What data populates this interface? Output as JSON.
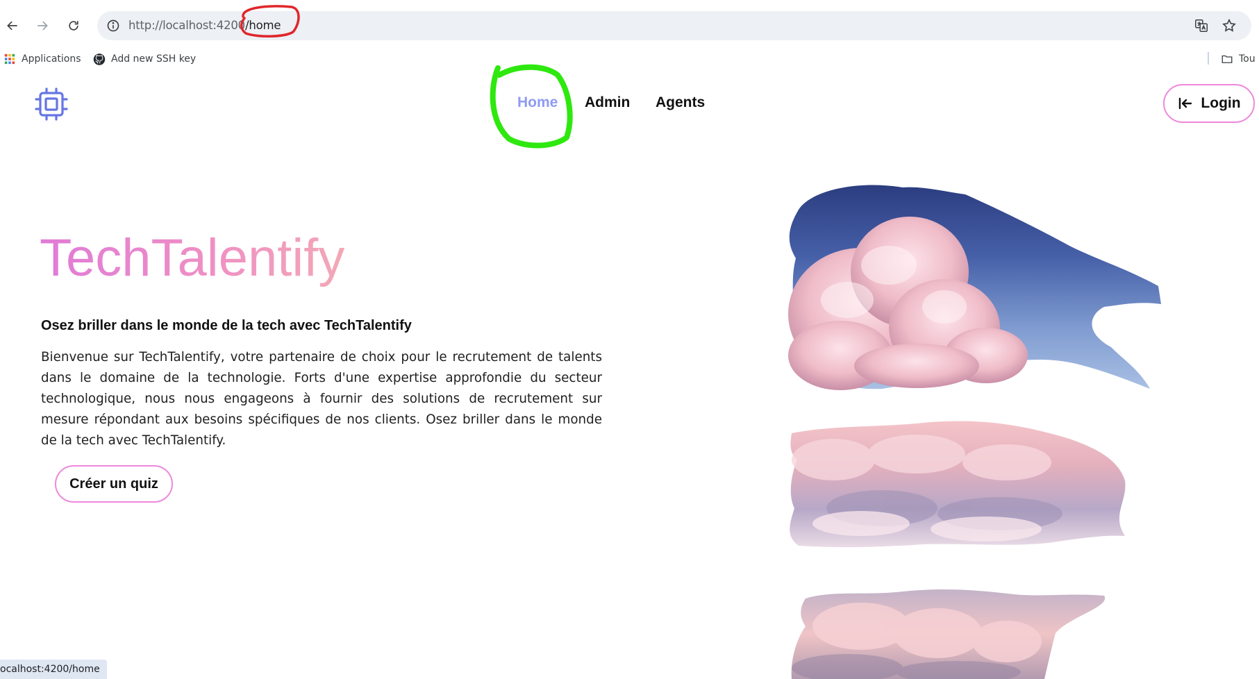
{
  "browser": {
    "url_host": "http://localhost:4200",
    "url_path": "/home",
    "bookmarks": [
      {
        "label": "Applications",
        "icon": "apps-grid-icon"
      },
      {
        "label": "Add new SSH key",
        "icon": "github-icon"
      }
    ],
    "other_bookmarks_label": "Tou",
    "status_text": "ocalhost:4200/home"
  },
  "site": {
    "nav": [
      {
        "label": "Home",
        "active": true
      },
      {
        "label": "Admin",
        "active": false
      },
      {
        "label": "Agents",
        "active": false
      }
    ],
    "login_label": "Login"
  },
  "hero": {
    "title": "TechTalentify",
    "subtitle": "Osez briller dans le monde de la tech avec TechTalentify",
    "paragraph": "Bienvenue sur TechTalentify, votre partenaire de choix pour le recrutement de talents dans le domaine de la technologie. Forts d'une expertise approfondie du secteur technologique, nous nous engageons à fournir des solutions de recrutement sur mesure répondant aux besoins spécifiques de nos clients. Osez briller dans le monde de la tech avec TechTalentify.",
    "cta_label": "Créer un quiz"
  },
  "colors": {
    "accent": "#8f9bf2",
    "logo": "#6576e4",
    "button_border": "#ee88dc",
    "title_gradient": [
      "#e07ad8",
      "#f3a8b6"
    ],
    "annotation_red": "#e0262b",
    "annotation_green": "#2ee80f"
  }
}
